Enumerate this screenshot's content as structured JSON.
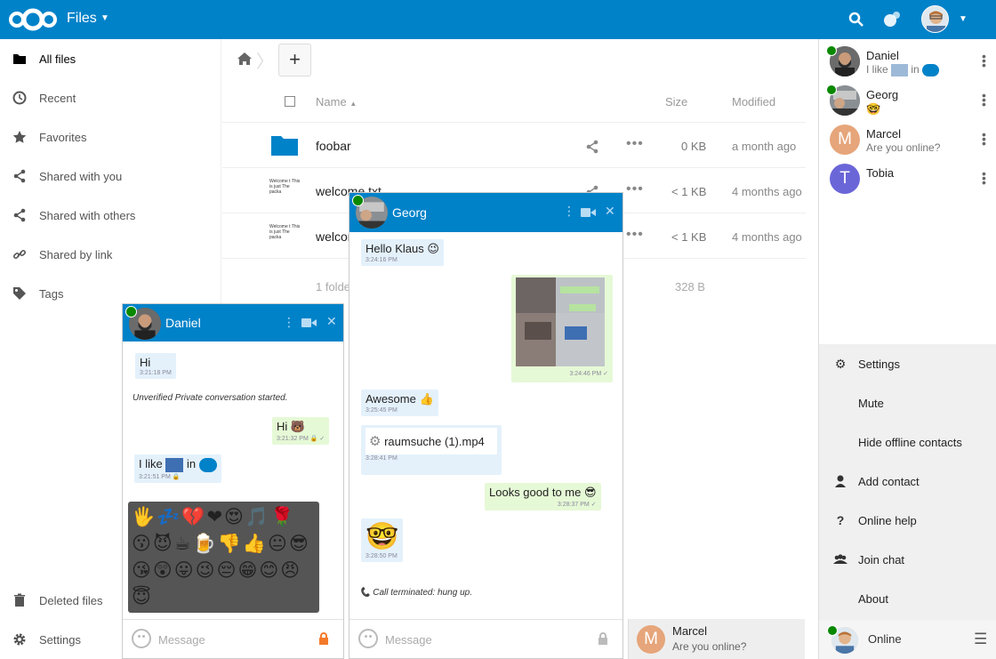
{
  "header": {
    "app_title": "Files",
    "icons": [
      "nextcloud-logo",
      "search-icon",
      "contacts-icon",
      "user-avatar",
      "caret-icon"
    ]
  },
  "sidebar": {
    "items": [
      {
        "label": "All files",
        "icon": "folder-icon"
      },
      {
        "label": "Recent",
        "icon": "clock-icon"
      },
      {
        "label": "Favorites",
        "icon": "star-icon"
      },
      {
        "label": "Shared with you",
        "icon": "share-icon"
      },
      {
        "label": "Shared with others",
        "icon": "share-icon"
      },
      {
        "label": "Shared by link",
        "icon": "link-icon"
      },
      {
        "label": "Tags",
        "icon": "tag-icon"
      }
    ],
    "footer": {
      "deleted_label": "Deleted files",
      "settings_label": "Settings"
    }
  },
  "files": {
    "columns": {
      "name": "Name",
      "size": "Size",
      "modified": "Modified"
    },
    "rows": [
      {
        "name": "foobar",
        "size": "0 KB",
        "modified": "a month ago"
      },
      {
        "name": "welcome.txt",
        "size": "< 1 KB",
        "modified": "4 months ago"
      },
      {
        "name": "welcome.txt",
        "size": "< 1 KB",
        "modified": "4 months ago"
      }
    ],
    "thumb_text": "Welcome t This is just The packa",
    "summary": "1 folder",
    "summary_size": "328 B"
  },
  "contacts": {
    "list": [
      {
        "name": "Daniel",
        "msg": "I like",
        "msg2": "in"
      },
      {
        "name": "Georg",
        "msg": ""
      },
      {
        "name": "Marcel",
        "msg": "Are you online?",
        "initial": "M"
      },
      {
        "name": "Tobia",
        "msg": "",
        "initial": "T"
      }
    ],
    "menu": [
      {
        "label": "Settings",
        "icon": "gear-icon"
      },
      {
        "label": "Mute",
        "icon": ""
      },
      {
        "label": "Hide offline contacts",
        "icon": ""
      },
      {
        "label": "Add contact",
        "icon": "add-contact-icon"
      },
      {
        "label": "Online help",
        "icon": "question-icon"
      },
      {
        "label": "Join chat",
        "icon": "group-icon"
      },
      {
        "label": "About",
        "icon": ""
      }
    ],
    "status_label": "Online"
  },
  "chat_daniel": {
    "title": "Daniel",
    "messages": [
      {
        "text": "Hi",
        "time": "3:21:18 PM"
      },
      {
        "text": "Hi 🐻",
        "time": "3:21:32 PM"
      },
      {
        "text": "I like",
        "text2": "in",
        "time": "3:21:51 PM"
      }
    ],
    "system": "Unverified Private conversation started.",
    "emojis": "🖐💤💔❤😍🎵🌹😗😈☕🍺👎👍😐😎😘😲😛😉😔😁😊😠😇",
    "placeholder": "Message"
  },
  "chat_georg": {
    "title": "Georg",
    "messages": [
      {
        "text": "Hello Klaus 😉",
        "time": "3:24:16 PM"
      },
      {
        "text": "",
        "time": "3:24:46 PM"
      },
      {
        "text": "Awesome 👍",
        "time": "3:25:45 PM"
      },
      {
        "text": "raumsuche (1).mp4",
        "time": "3:28:41 PM"
      },
      {
        "text": "Looks good to me 😎",
        "time": "3:28:37 PM"
      },
      {
        "text": "🤓",
        "time": "3:28:50 PM"
      }
    ],
    "system": "Call terminated: hung up.",
    "placeholder": "Message"
  },
  "minimized_chat": {
    "initial": "M",
    "name": "Marcel",
    "msg": "Are you online?"
  },
  "colors": {
    "brand": "#0082c9",
    "online": "#0a8800",
    "in_bubble": "#e4f1fb",
    "out_bubble": "#e6f9d6"
  }
}
